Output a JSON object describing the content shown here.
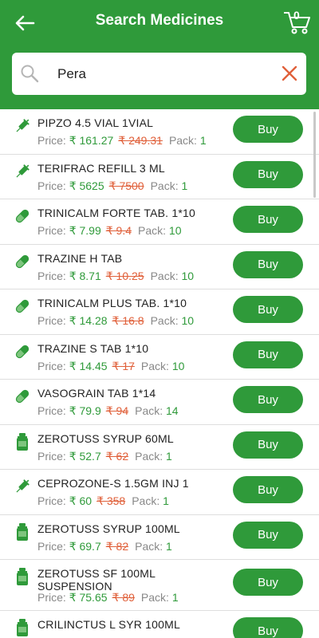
{
  "header": {
    "title": "Search Medicines",
    "cart_count": "0",
    "colors": {
      "primary": "#2f9a3a",
      "mrp": "#e0603a"
    }
  },
  "search": {
    "value": "Pera",
    "placeholder": ""
  },
  "labels": {
    "price": "Price:",
    "pack": "Pack:",
    "currency": "₹",
    "buy": "Buy"
  },
  "items": [
    {
      "name": "PIPZO 4.5 VIAL 1VIAL",
      "price": "161.27",
      "mrp": "249.31",
      "pack": "1",
      "icon": "syringe-icon"
    },
    {
      "name": "TERIFRAC REFILL 3 ML",
      "price": "5625",
      "mrp": "7500",
      "pack": "1",
      "icon": "syringe-icon"
    },
    {
      "name": "TRINICALM FORTE  TAB. 1*10",
      "price": "7.99",
      "mrp": "9.4",
      "pack": "10",
      "icon": "capsule-icon"
    },
    {
      "name": "TRAZINE H TAB",
      "price": "8.71",
      "mrp": "10.25",
      "pack": "10",
      "icon": "capsule-icon"
    },
    {
      "name": "TRINICALM PLUS TAB. 1*10",
      "price": "14.28",
      "mrp": "16.8",
      "pack": "10",
      "icon": "capsule-icon"
    },
    {
      "name": "TRAZINE S TAB 1*10",
      "price": "14.45",
      "mrp": "17",
      "pack": "10",
      "icon": "capsule-icon"
    },
    {
      "name": "VASOGRAIN TAB 1*14",
      "price": "79.9",
      "mrp": "94",
      "pack": "14",
      "icon": "capsule-icon"
    },
    {
      "name": "ZEROTUSS SYRUP 60ML",
      "price": "52.7",
      "mrp": "62",
      "pack": "1",
      "icon": "bottle-icon"
    },
    {
      "name": "CEPROZONE-S 1.5GM INJ 1",
      "price": "60",
      "mrp": "358",
      "pack": "1",
      "icon": "syringe-icon"
    },
    {
      "name": "ZEROTUSS SYRUP 100ML",
      "price": "69.7",
      "mrp": "82",
      "pack": "1",
      "icon": "bottle-icon"
    },
    {
      "name": "ZEROTUSS SF 100ML SUSPENSION",
      "price": "75.65",
      "mrp": "89",
      "pack": "1",
      "icon": "bottle-icon"
    },
    {
      "name": "CRILINCTUS L SYR 100ML",
      "price": "",
      "mrp": "",
      "pack": "",
      "icon": "bottle-icon"
    }
  ]
}
